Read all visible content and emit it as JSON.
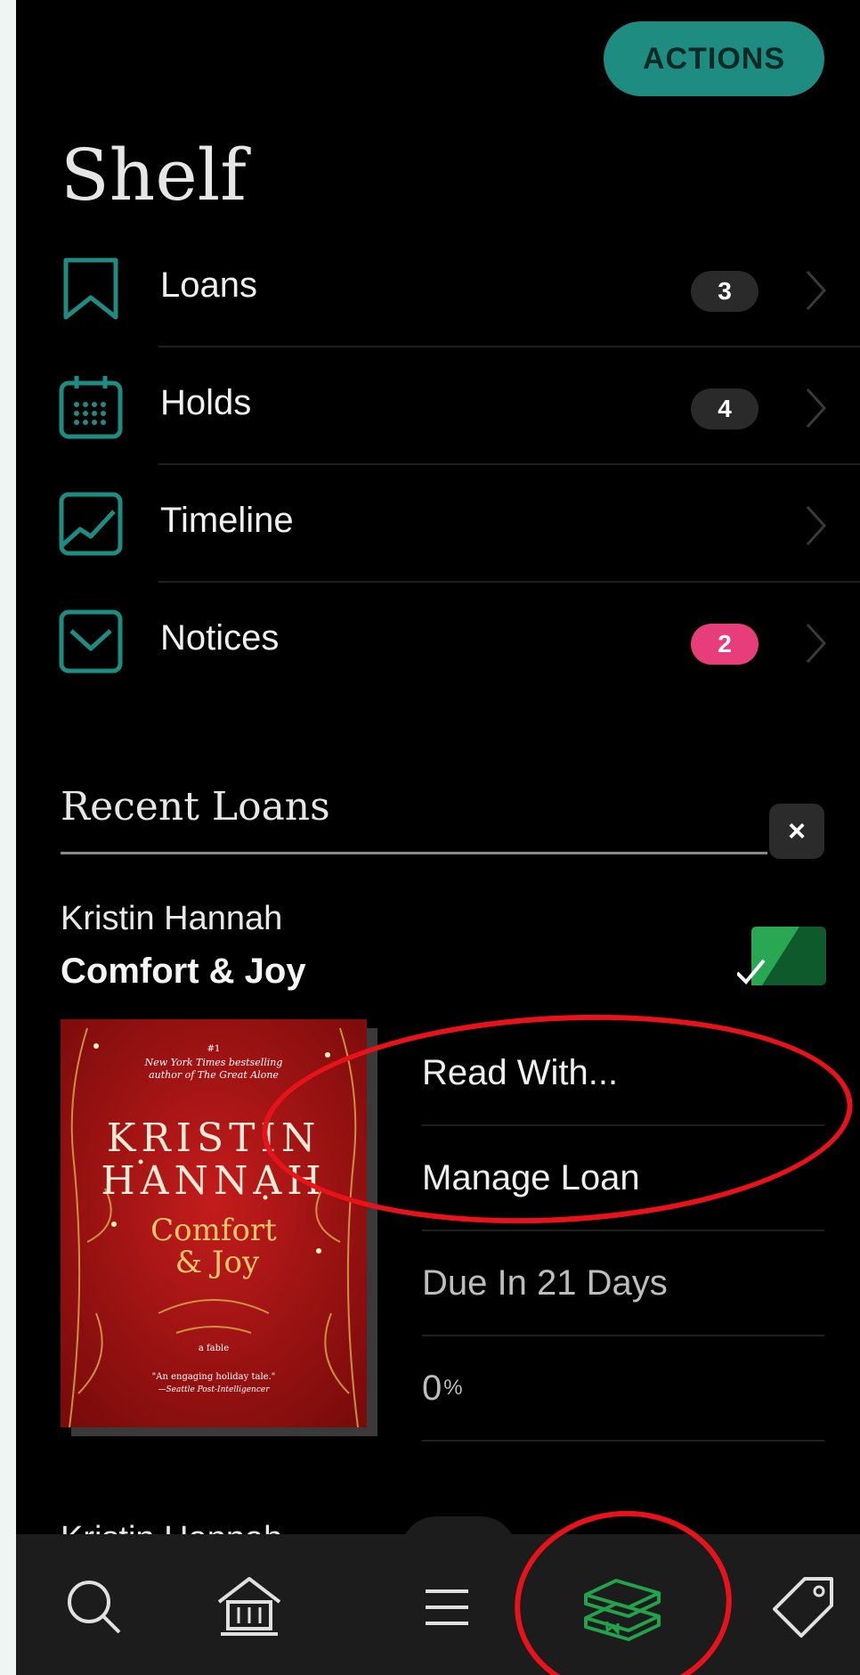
{
  "header": {
    "actions_label": "ACTIONS",
    "title": "Shelf"
  },
  "shelf": [
    {
      "label": "Loans",
      "badge": "3",
      "icon": "bookmark-icon"
    },
    {
      "label": "Holds",
      "badge": "4",
      "icon": "calendar-icon"
    },
    {
      "label": "Timeline",
      "badge": "",
      "icon": "chart-icon"
    },
    {
      "label": "Notices",
      "badge": "2",
      "icon": "mail-icon"
    }
  ],
  "recent_loans": {
    "title": "Recent Loans",
    "close_label": "×",
    "book": {
      "author": "Kristin Hannah",
      "title": "Comfort & Joy",
      "cover": {
        "top_line": "#1",
        "blurb1": "New York Times bestselling",
        "blurb2": "author of The Great Alone",
        "author_line1": "KRISTIN",
        "author_line2": "HANNAH",
        "title_line1": "Comfort",
        "title_line2": "& Joy",
        "subtitle": "a fable",
        "quote": "\"An engaging holiday tale.\"",
        "quote_source": "—Seattle Post-Intelligencer"
      },
      "actions": {
        "read_with": "Read With...",
        "manage_loan": "Manage Loan",
        "due": "Due In 21 Days",
        "progress_value": "0",
        "progress_unit": "%"
      }
    },
    "next_author": "Kristin Hannah"
  },
  "tabbar": [
    "search-icon",
    "library-icon",
    "menu-icon",
    "books-stack-icon",
    "tag-icon"
  ],
  "colors": {
    "accent": "#1e8c80",
    "pink": "#e73d7a",
    "active_tab": "#22a24b",
    "annotation": "#e8131a"
  }
}
